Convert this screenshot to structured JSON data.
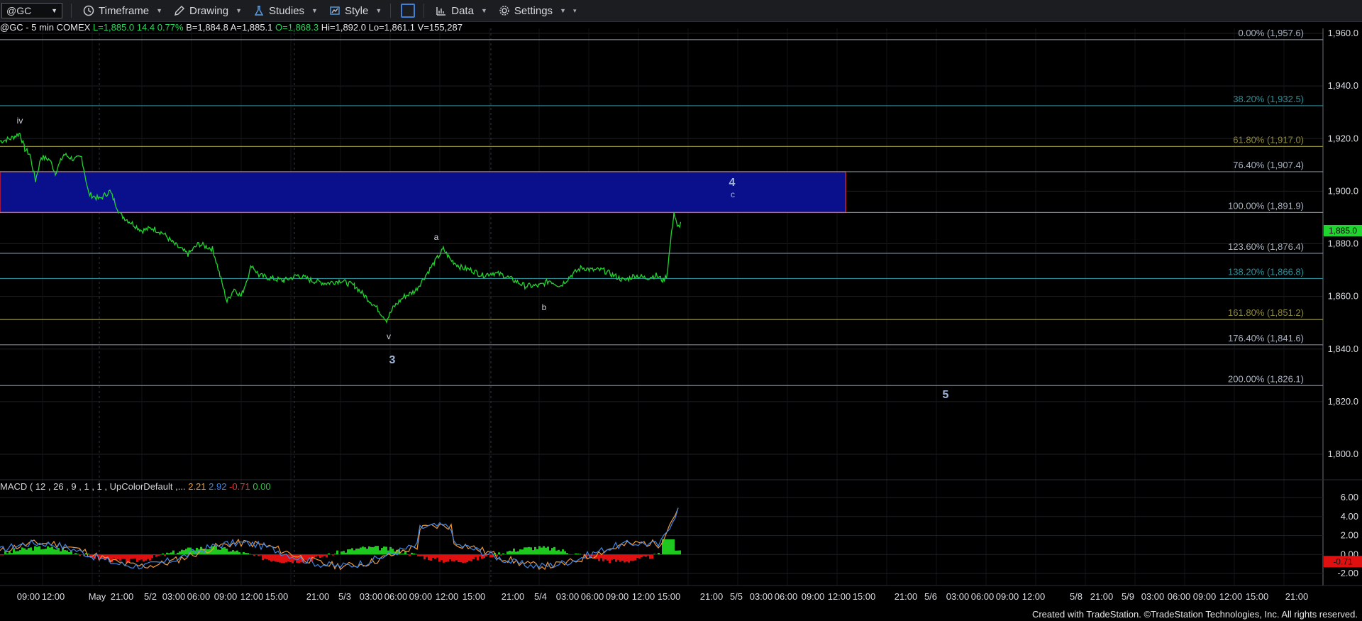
{
  "toolbar": {
    "symbol": "@GC",
    "timeframe": "Timeframe",
    "drawing": "Drawing",
    "studies": "Studies",
    "style": "Style",
    "data": "Data",
    "settings": "Settings"
  },
  "info": {
    "symbol_desc": "@GC - 5 min  COMEX",
    "last": "L=1,885.0",
    "change": "14.4",
    "pct": "0.77%",
    "bid": "B=1,884.8",
    "ask": "A=1,885.1",
    "open": "O=1,868.3",
    "high": "Hi=1,892.0",
    "low": "Lo=1,861.1",
    "volume": "V=155,287"
  },
  "price_axis": {
    "ticks": [
      "1,960.0",
      "1,940.0",
      "1,920.0",
      "1,900.0",
      "1,880.0",
      "1,860.0",
      "1,840.0",
      "1,820.0",
      "1,800.0"
    ],
    "last_price_tag": "1,885.0"
  },
  "fib_levels": [
    {
      "label": "0.00% (1,957.6)",
      "value": 1957.6,
      "color": "#7c8794"
    },
    {
      "label": "38.20% (1,932.5)",
      "value": 1932.5,
      "color": "#2d8f9a"
    },
    {
      "label": "61.80% (1,917.0)",
      "value": 1917.0,
      "color": "#8e8a3c"
    },
    {
      "label": "76.40% (1,907.4)",
      "value": 1907.4,
      "color": "#7c8794"
    },
    {
      "label": "100.00% (1,891.9)",
      "value": 1891.9,
      "color": "#7c8794"
    },
    {
      "label": "123.60% (1,876.4)",
      "value": 1876.4,
      "color": "#7c8794"
    },
    {
      "label": "138.20% (1,866.8)",
      "value": 1866.8,
      "color": "#2d8f9a"
    },
    {
      "label": "161.80% (1,851.2)",
      "value": 1851.2,
      "color": "#8e8a3c"
    },
    {
      "label": "176.40% (1,841.6)",
      "value": 1841.6,
      "color": "#7c8794"
    },
    {
      "label": "200.00% (1,826.1)",
      "value": 1826.1,
      "color": "#7c8794"
    }
  ],
  "wave_labels": {
    "iv": "iv",
    "a": "a",
    "b": "b",
    "v": "v",
    "three": "3",
    "four": "4",
    "c": "c",
    "five": "5"
  },
  "target_zone": {
    "top": 1907.4,
    "bottom": 1891.9,
    "fill": "#0a0f8c",
    "border": "#d01c2b"
  },
  "macd": {
    "title": "MACD ( 12 , 26 , 9 , 1 , 1 , UpColorDefault ,...",
    "v1": "2.21",
    "v2": "2.92",
    "v3": "-0.71",
    "v4": "0.00",
    "axis_ticks": [
      "6.00",
      "4.00",
      "2.00",
      "0.00",
      "-2.00"
    ],
    "last_tag": "-0.71"
  },
  "time_axis": [
    "09:00",
    "12:00",
    "May",
    "21:00",
    "5/2",
    "03:00",
    "06:00",
    "09:00",
    "12:00",
    "15:00",
    "21:00",
    "5/3",
    "03:00",
    "06:00",
    "09:00",
    "12:00",
    "15:00",
    "21:00",
    "5/4",
    "03:00",
    "06:00",
    "09:00",
    "12:00",
    "15:00",
    "21:00",
    "5/5",
    "03:00",
    "06:00",
    "09:00",
    "12:00",
    "15:00",
    "21:00",
    "5/6",
    "03:00",
    "06:00",
    "09:00",
    "12:00",
    "5/8",
    "21:00",
    "5/9",
    "03:00",
    "06:00",
    "09:00",
    "12:00",
    "15:00",
    "21:00"
  ],
  "footer": "Created with TradeStation. ©TradeStation Technologies, Inc. All rights reserved.",
  "colors": {
    "price_line": "#1fd62e",
    "background": "#000000",
    "macd_up": "#1fc81f",
    "macd_down": "#e01010"
  }
}
